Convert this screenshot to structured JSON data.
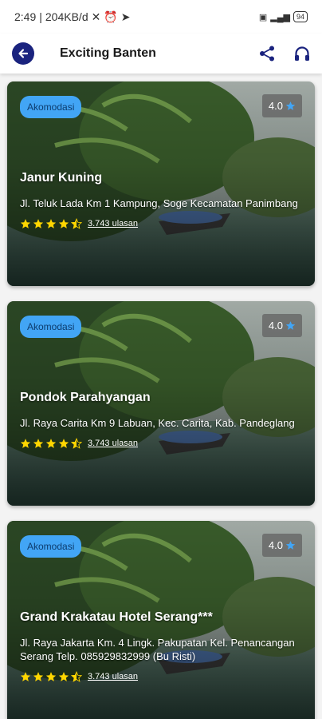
{
  "status_bar": {
    "time": "2:49",
    "speed": "204KB/d",
    "battery": "94"
  },
  "app_bar": {
    "title": "Exciting Banten"
  },
  "colors": {
    "accent": "#42a5f5",
    "back_button": "#1a237e",
    "star": "#ffd600",
    "star_rating_icon": "#42a5f5"
  },
  "cards": [
    {
      "category": "Akomodasi",
      "rating": "4.0",
      "name": "Janur Kuning",
      "address": "Jl. Teluk Lada Km 1 Kampung, Soge Kecamatan Panimbang",
      "reviews": "3.743 ulasan",
      "stars": 4.5
    },
    {
      "category": "Akomodasi",
      "rating": "4.0",
      "name": "Pondok Parahyangan",
      "address": "Jl. Raya Carita Km 9 Labuan, Kec. Carita, Kab. Pandeglang",
      "reviews": "3.743 ulasan",
      "stars": 4.5
    },
    {
      "category": "Akomodasi",
      "rating": "4.0",
      "name": "Grand Krakatau Hotel Serang***",
      "address": "Jl. Raya Jakarta Km. 4 Lingk. Pakupatan Kel. Penancangan Serang Telp. 085929832999 (Bu Risti)",
      "reviews": "3.743 ulasan",
      "stars": 4.5
    }
  ]
}
